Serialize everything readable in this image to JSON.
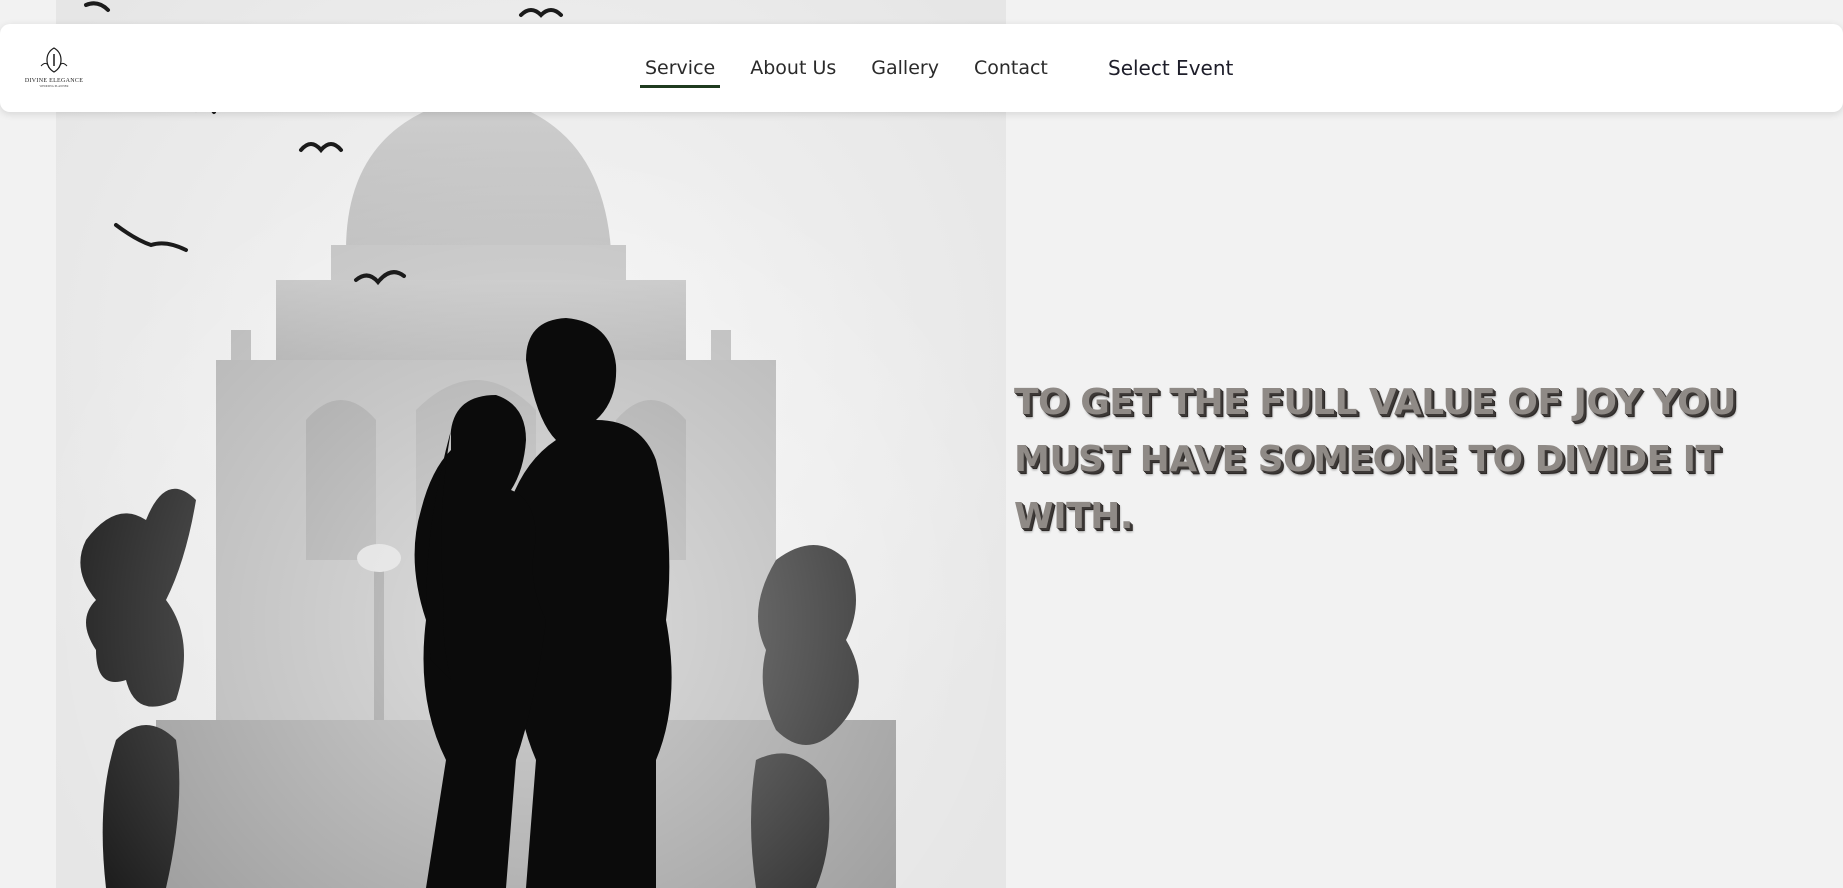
{
  "brand": {
    "name": "DIVINE ELEGANCE",
    "tagline": "WEDDING PLANNER"
  },
  "nav": {
    "items": [
      {
        "label": "Service",
        "active": true
      },
      {
        "label": "About Us",
        "active": false
      },
      {
        "label": "Gallery",
        "active": false
      },
      {
        "label": "Contact",
        "active": false
      }
    ],
    "select_event_label": "Select Event"
  },
  "hero": {
    "quote": "TO GET THE FULL VALUE OF JOY YOU MUST HAVE SOMEONE TO DIVIDE IT WITH.",
    "image_icon": "couple-photo"
  },
  "colors": {
    "background": "#f2f2f2",
    "header": "#ffffff",
    "active_underline": "#1f3b1f",
    "quote_fill": "#8f8a86",
    "quote_shadow": "#3c3836"
  }
}
